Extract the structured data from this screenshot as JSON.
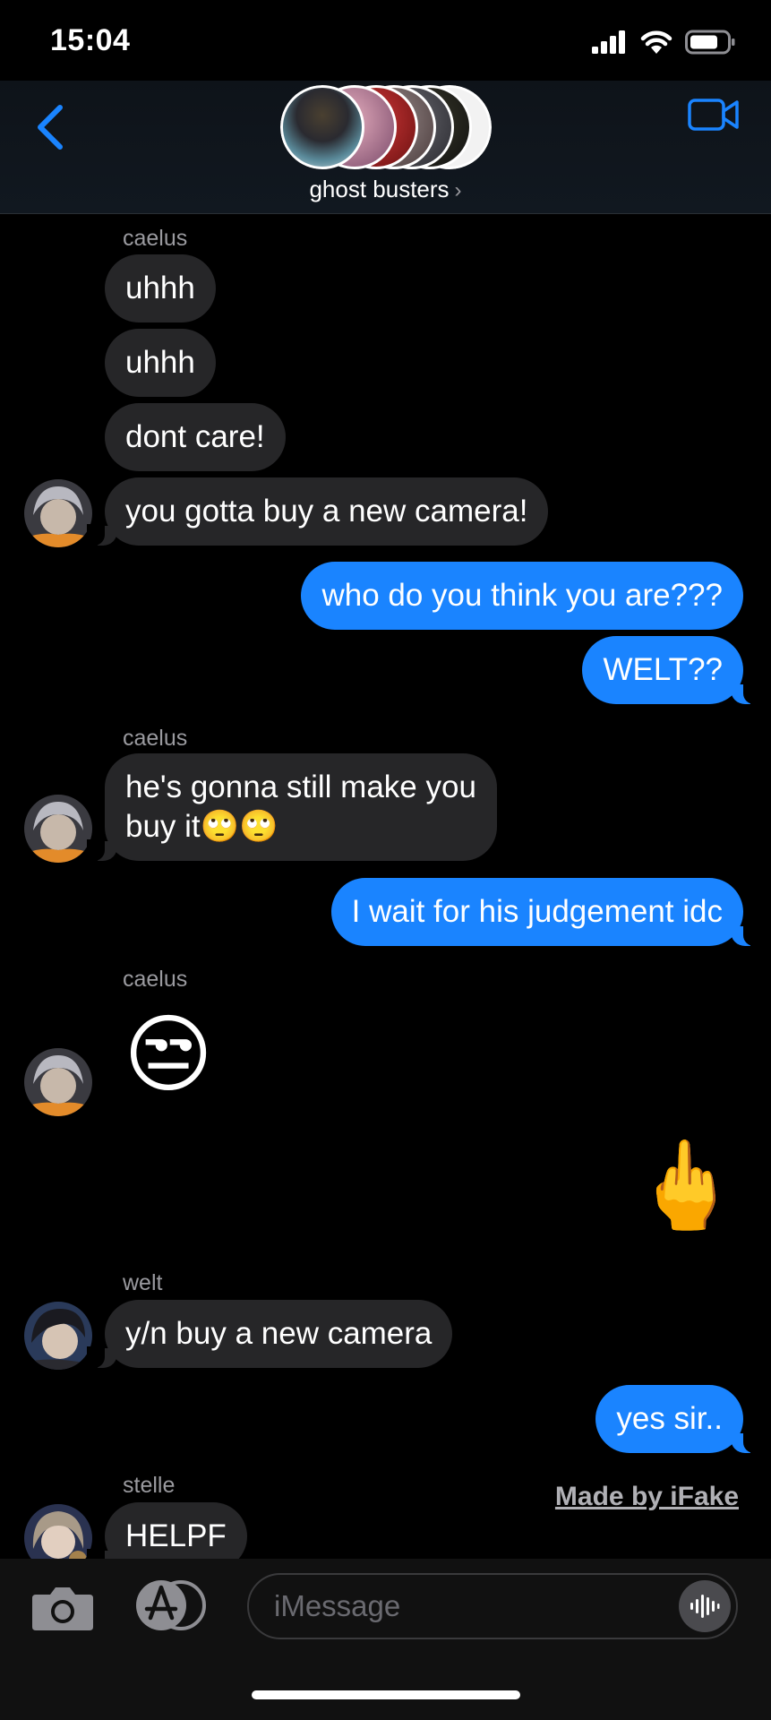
{
  "status_bar": {
    "time": "15:04",
    "icons": [
      "signal-icon",
      "wifi-icon",
      "battery-icon"
    ]
  },
  "header": {
    "group_name": "ghost busters",
    "chevron": "›",
    "back_icon": "chevron-left-icon",
    "video_icon": "video-camera-icon",
    "accent_color": "#1a84ff"
  },
  "messages": [
    {
      "kind": "sender",
      "text": "caelus"
    },
    {
      "kind": "in",
      "text": "uhhh"
    },
    {
      "kind": "in",
      "text": "uhhh"
    },
    {
      "kind": "in",
      "text": "dont care!"
    },
    {
      "kind": "in",
      "text": "you gotta buy a new camera!",
      "avatar": "caelus"
    },
    {
      "kind": "out",
      "text": "who do you think you are???"
    },
    {
      "kind": "out",
      "text": "WELT??"
    },
    {
      "kind": "sender",
      "text": "caelus"
    },
    {
      "kind": "in",
      "text": "he's gonna still make you buy it🙄🙄",
      "line1": "he's gonna still make you",
      "line2": "buy it🙄🙄",
      "avatar": "caelus"
    },
    {
      "kind": "out",
      "text": "I wait for his judgement idc"
    },
    {
      "kind": "sender",
      "text": "caelus"
    },
    {
      "kind": "emoji-in",
      "text": "😒",
      "avatar": "caelus"
    },
    {
      "kind": "emoji-out",
      "text": "🖕"
    },
    {
      "kind": "sender",
      "text": "welt"
    },
    {
      "kind": "in",
      "text": "y/n buy a new camera",
      "avatar": "welt"
    },
    {
      "kind": "out",
      "text": "yes sir.."
    },
    {
      "kind": "sender",
      "text": "stelle"
    },
    {
      "kind": "in",
      "text": "HELPF",
      "avatar": "stelle"
    }
  ],
  "watermark": "Made by iFake",
  "input_bar": {
    "placeholder": "iMessage",
    "icons": [
      "camera-icon",
      "app-store-icon",
      "audio-waveform-icon"
    ]
  },
  "colors": {
    "incoming_bubble": "#262628",
    "outgoing_bubble": "#1a84ff",
    "background": "#000000"
  }
}
